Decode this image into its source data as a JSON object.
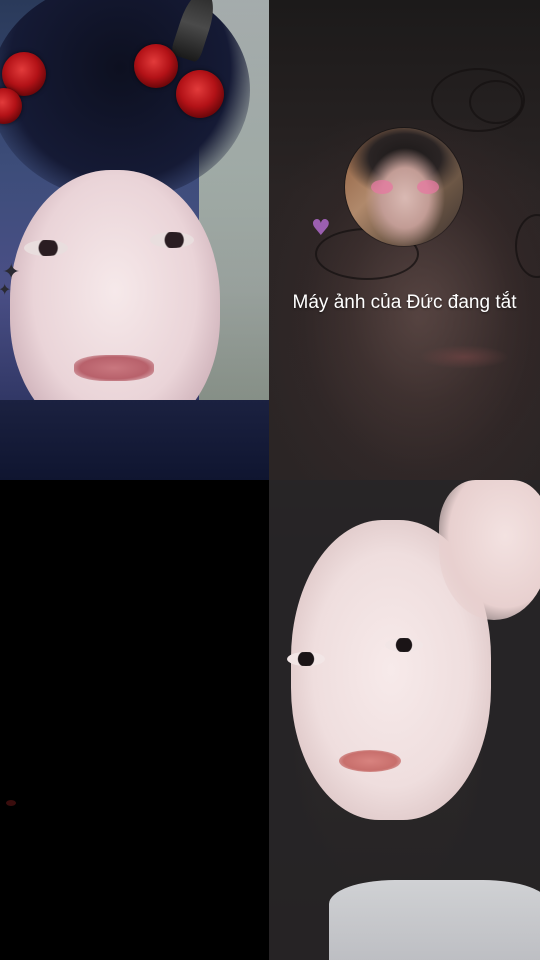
{
  "call": {
    "participants": [
      {
        "tile": "top-left",
        "camera_on": true
      },
      {
        "tile": "top-right",
        "camera_on": false,
        "status_text": "Máy ảnh của Đức đang tắt"
      },
      {
        "tile": "bottom-left",
        "camera_on": false
      },
      {
        "tile": "bottom-right",
        "camera_on": true
      }
    ]
  },
  "colors": {
    "background": "#000000",
    "status_text": "#ffffff"
  }
}
